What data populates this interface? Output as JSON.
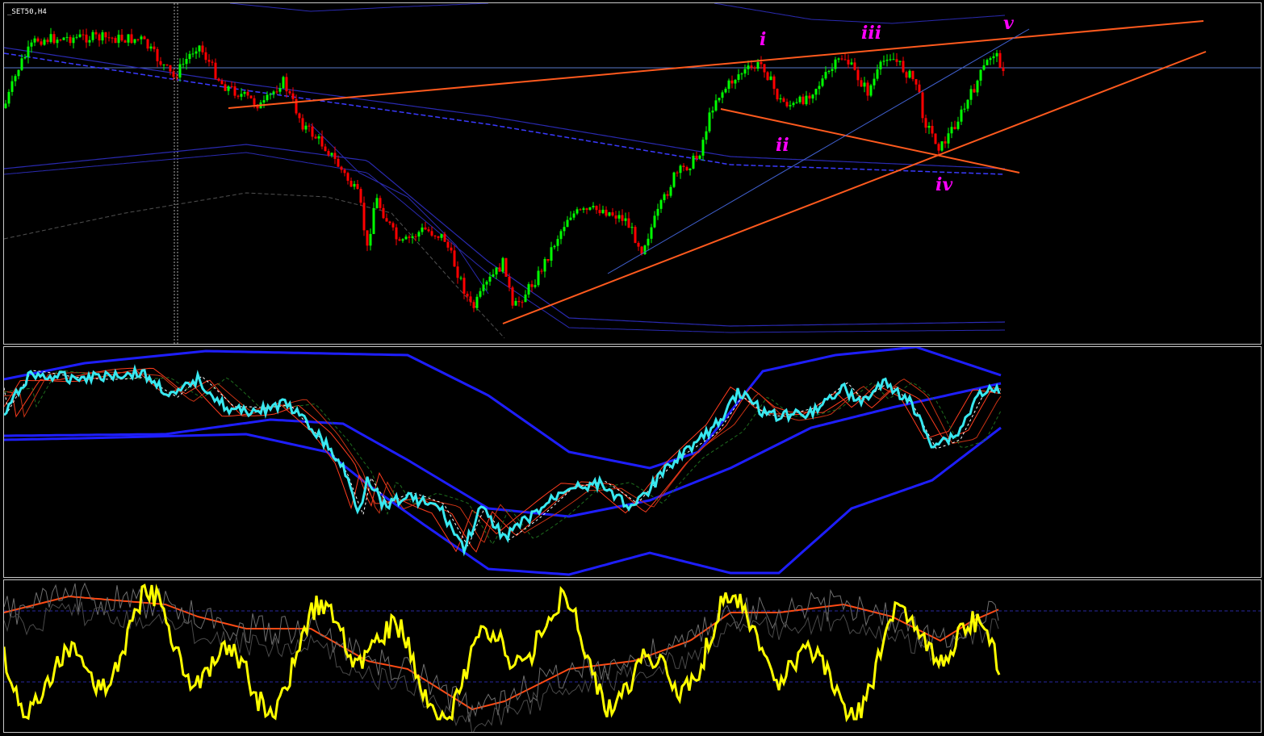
{
  "chart": {
    "symbol_label": "_SET50,H4",
    "colors": {
      "background": "#000000",
      "bull_candle": "#00ff00",
      "bear_candle": "#ff0000",
      "trendline": "#ff5a1e",
      "channel": "#3a3aff",
      "wave_label": "#ff00ff",
      "oscillator": "#38e8f0",
      "stochastic": "#ffff00"
    },
    "wave_labels": [
      {
        "id": "i",
        "text": "i"
      },
      {
        "id": "ii",
        "text": "ii"
      },
      {
        "id": "iii",
        "text": "iii"
      },
      {
        "id": "iv",
        "text": "iv"
      },
      {
        "id": "v",
        "text": "v"
      }
    ]
  }
}
